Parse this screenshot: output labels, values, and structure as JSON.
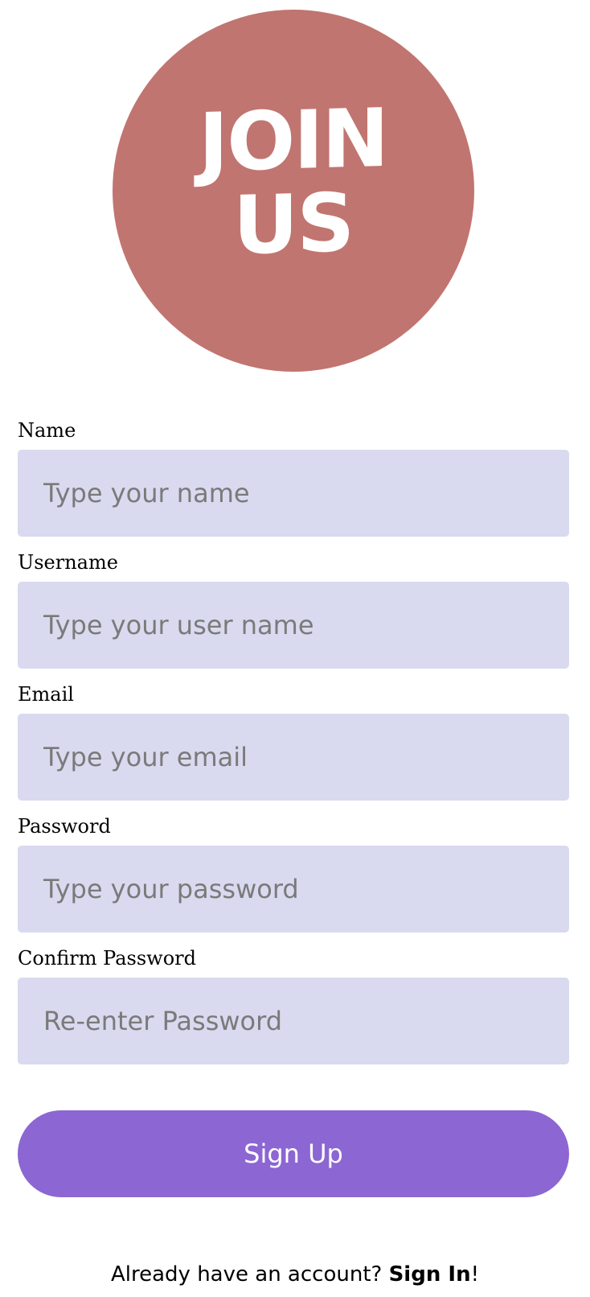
{
  "logo": {
    "line1": "JOIN",
    "line2": "US",
    "color": "#c17570"
  },
  "form": {
    "fields": [
      {
        "label": "Name",
        "placeholder": "Type your name"
      },
      {
        "label": "Username",
        "placeholder": "Type your user name"
      },
      {
        "label": "Email",
        "placeholder": "Type your email"
      },
      {
        "label": "Password",
        "placeholder": "Type your password"
      },
      {
        "label": "Confirm Password",
        "placeholder": "Re-enter Password"
      }
    ],
    "input_background": "#d9daef",
    "submit_label": "Sign Up",
    "submit_color": "#8c66d3"
  },
  "footer": {
    "prompt": "Already have an account? ",
    "link": "Sign In",
    "suffix": "!"
  }
}
